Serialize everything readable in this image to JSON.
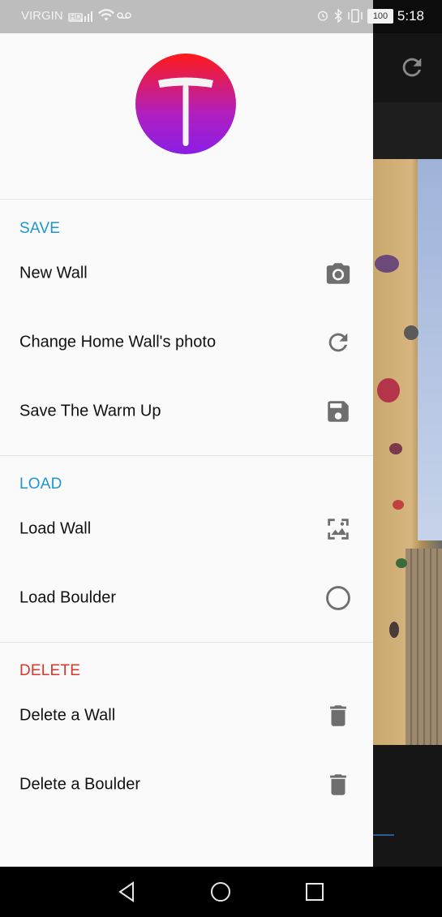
{
  "status_bar": {
    "carrier": "VIRGIN",
    "network_badge": "HD",
    "battery": "100",
    "time": "5:18"
  },
  "colors": {
    "accent_blue": "#1f96d3",
    "accent_red": "#d9362b",
    "icon_gray": "#6e6e6e"
  },
  "drawer": {
    "logo_icon": "app-logo-t-icon",
    "sections": [
      {
        "label": "SAVE",
        "items": [
          {
            "label": "New Wall",
            "icon": "camera-icon"
          },
          {
            "label": "Change Home Wall's photo",
            "icon": "refresh-icon"
          },
          {
            "label": "Save The Warm Up",
            "icon": "floppy-disk-icon"
          }
        ]
      },
      {
        "label": "LOAD",
        "items": [
          {
            "label": "Load Wall",
            "icon": "image-icon"
          },
          {
            "label": "Load Boulder",
            "icon": "circle-icon"
          }
        ]
      },
      {
        "label": "DELETE",
        "items": [
          {
            "label": "Delete a Wall",
            "icon": "trash-icon"
          },
          {
            "label": "Delete a Boulder",
            "icon": "trash-icon"
          }
        ]
      }
    ]
  },
  "background_app": {
    "refresh_icon": "refresh-icon"
  },
  "nav_bar": {
    "back_icon": "back-triangle-icon",
    "home_icon": "home-circle-icon",
    "recents_icon": "recents-square-icon"
  }
}
